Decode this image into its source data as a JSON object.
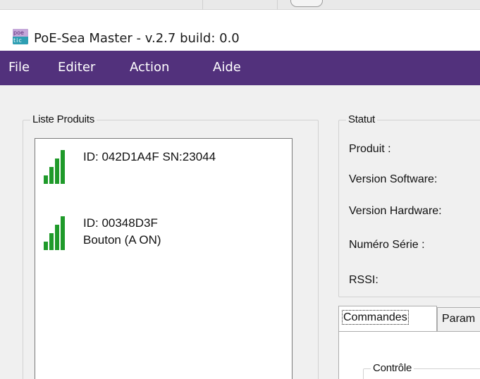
{
  "window": {
    "title": "PoE-Sea Master - v.2.7   build: 0.0",
    "icon": "poetic-app-icon",
    "icon_top_text": "poe",
    "icon_bottom_text": "tic"
  },
  "menu": {
    "items": [
      "File",
      "Editer",
      "Action",
      "Aide"
    ]
  },
  "products": {
    "legend": "Liste Produits",
    "items": [
      {
        "line1": "ID: 042D1A4F SN:23044",
        "line2": "",
        "signal_level": 4,
        "signal_max": 4
      },
      {
        "line1": "ID: 00348D3F",
        "line2": "Bouton (A ON)",
        "signal_level": 4,
        "signal_max": 4
      }
    ]
  },
  "status": {
    "legend": "Statut",
    "labels": [
      "Produit :",
      "Version Software:",
      "Version Hardware:",
      "Numéro Série :",
      "RSSI:"
    ]
  },
  "tabs": {
    "items": [
      "Commandes",
      "Param"
    ],
    "active": "Commandes"
  },
  "control": {
    "legend": "Contrôle"
  },
  "colors": {
    "menubar": "#52317c",
    "signal": "#1f9a2a"
  }
}
